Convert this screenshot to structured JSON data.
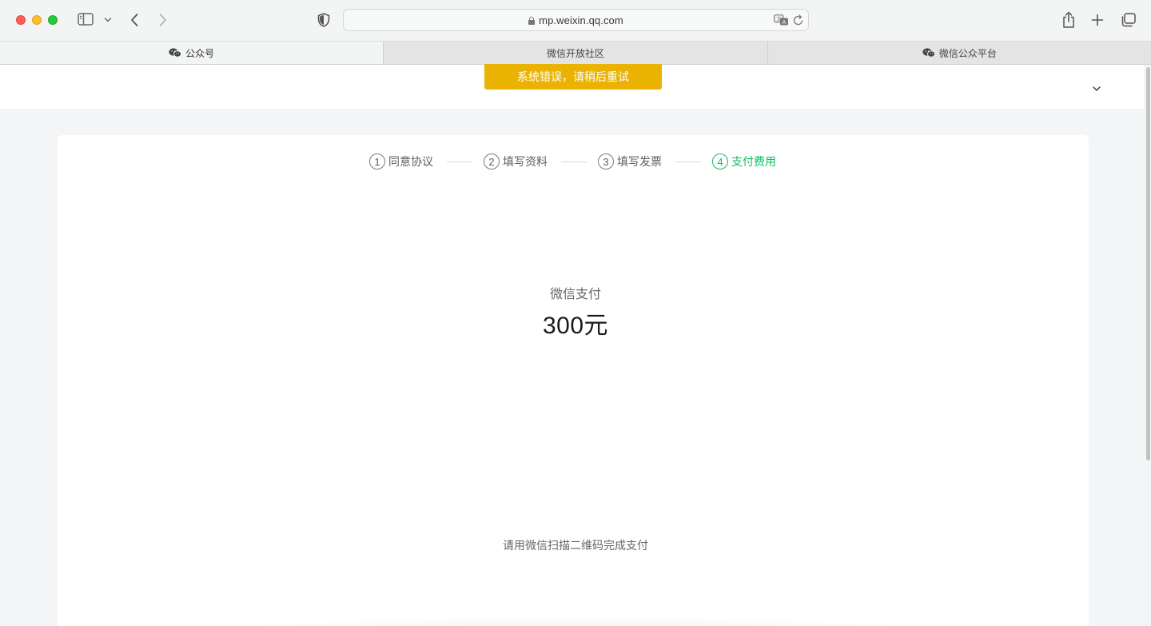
{
  "browser": {
    "url": "mp.weixin.qq.com"
  },
  "tabs": [
    {
      "label": "公众号",
      "icon": "wechat-icon",
      "active": true
    },
    {
      "label": "微信开放社区",
      "active": false
    },
    {
      "label": "微信公众平台",
      "icon": "wechat-icon",
      "active": false
    }
  ],
  "toast": {
    "message": "系统错误，请稍后重试",
    "color": "#eab304"
  },
  "steps": [
    {
      "num": "1",
      "label": "同意协议"
    },
    {
      "num": "2",
      "label": "填写资料"
    },
    {
      "num": "3",
      "label": "填写发票"
    },
    {
      "num": "4",
      "label": "支付费用",
      "current": true
    }
  ],
  "payment": {
    "method": "微信支付",
    "amount": "300元",
    "tip": "请用微信扫描二维码完成支付"
  },
  "colors": {
    "accent": "#07c160"
  }
}
